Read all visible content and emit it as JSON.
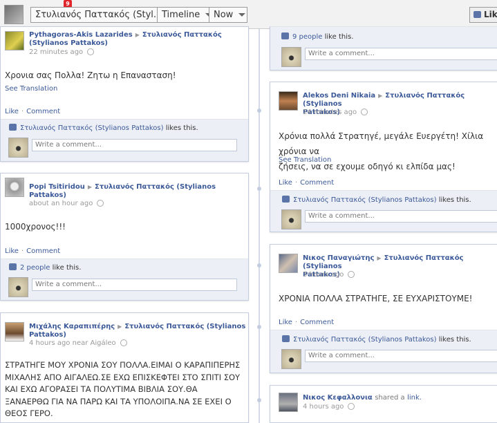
{
  "header": {
    "badge": "9",
    "name_button": "Στυλιανός Παττακός (Styl...",
    "timeline_button": "Timeline",
    "now_button": "Now",
    "like_button": "Lik"
  },
  "comment_placeholder": "Write a comment...",
  "actions": {
    "like": "Like",
    "comment": "Comment"
  },
  "see_translation": "See Translation",
  "left_posts": [
    {
      "author": "Pythagoras-Akis Lazarides",
      "target": "Στυλιανός Παττακός",
      "target2": "(Stylianos Pattakos)",
      "time": "22 minutes ago",
      "message": "Χρονια σας Πολλα! Ζητω η Επανασταση!",
      "likes_link": "Στυλιανός Παττακός (Stylianos Pattakos)",
      "likes_text": "likes this."
    },
    {
      "author": "Popi Tsitiridou",
      "target": "Στυλιανός Παττακός (Stylianos",
      "target2": "Pattakos)",
      "time": "about an hour ago",
      "message": "1000χρονος!!!",
      "likes_link": "2 people",
      "likes_text": "like this."
    },
    {
      "author": "Μιχάλης Καραπιπέρης",
      "target": "Στυλιανός Παττακός (Stylianos",
      "target2": "Pattakos)",
      "time": "4 hours ago near Aigáleo",
      "message_lines": [
        "ΣΤΡΑΤΗΓΕ ΜΟΥ ΧΡΟΝΙΑ ΣΟΥ ΠΟΛΛΑ.ΕΙΜΑΙ Ο ΚΑΡΑΠΙΠΕΡΗΣ",
        "ΜΙΧΑΛΗΣ ΑΠΟ ΑΙΓΑΛΕΩ.ΣΕ ΕΧΩ ΕΠΙΣΚΕΦΤΕΙ ΣΤΟ ΣΠΙΤΙ ΣΟΥ",
        "ΚΑΙ ΕΧΩ ΑΓΟΡΑΣΕΙ ΤΑ ΠΟΛΥΤΙΜΑ ΒΙΒΛΙΑ ΣΟΥ.ΘΑ",
        "ΞΑΝΑΕΡΘΩ ΓΙΑ ΝΑ ΠΑΡΩ ΚΑΙ ΤΑ ΥΠΟΛΟΙΠΑ.ΝΑ ΣΕ ΕΧΕΙ Ο",
        "ΘΕΟΣ ΓΕΡΟ."
      ]
    }
  ],
  "right_posts": [
    {
      "likes_link": "9 people",
      "likes_text": "like this."
    },
    {
      "author": "Alekos Deni Nikaia",
      "target": "Στυλιανός Παττακός (Stylianos",
      "target2": "Pattakos)",
      "time": "24 minutes ago",
      "message_lines": [
        "Χρόνια πολλά Στρατηγέ, μεγάλε Ευεργέτη! Χίλια χρόνια να",
        "ζήσεις, να σε εχουμε οδηγό κι ελπίδα μας!"
      ],
      "likes_link": "Στυλιανός Παττακός (Stylianos Pattakos)",
      "likes_text": "likes this."
    },
    {
      "author": "Νικος Παναγιώτης",
      "target": "Στυλιανός Παττακός (Stylianos",
      "target2": "Pattakos)",
      "time": "3 hours ago",
      "message": "ΧΡΟΝΙΑ ΠΟΛΛΑ ΣΤΡΑΤΗΓΕ, ΣΕ ΕΥΧΑΡΙΣΤΟΥΜΕ!",
      "likes_link": "Στυλιανός Παττακός (Stylianos Pattakos)",
      "likes_text": "likes this."
    },
    {
      "author": "Νικος Κεφαλλονια",
      "shared_text": "shared a",
      "shared_link": "link.",
      "time": "4 hours ago"
    }
  ]
}
